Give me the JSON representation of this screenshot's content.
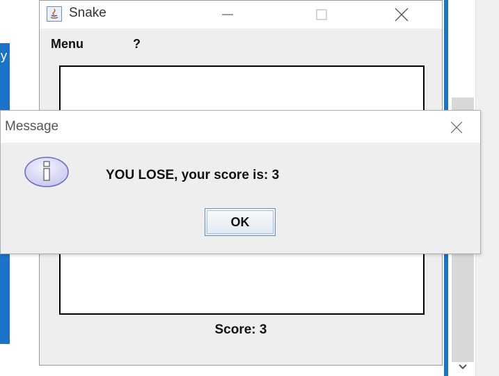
{
  "background": {
    "code_fragment": "y)"
  },
  "snake_window": {
    "title": "Snake",
    "icon": "java-icon",
    "menu": {
      "items": [
        {
          "label": "Menu"
        },
        {
          "label": "?"
        }
      ]
    },
    "score_label": "Score:  3"
  },
  "dialog": {
    "title": "Message",
    "icon": "info-icon",
    "message": "YOU LOSE, your score is: 3",
    "ok_label": "OK"
  },
  "colors": {
    "accent_blue": "#1a73c9",
    "dialog_background": "#eeeeee",
    "info_icon_fill": "#d9d9f5",
    "info_icon_border": "#6f6fbf"
  }
}
